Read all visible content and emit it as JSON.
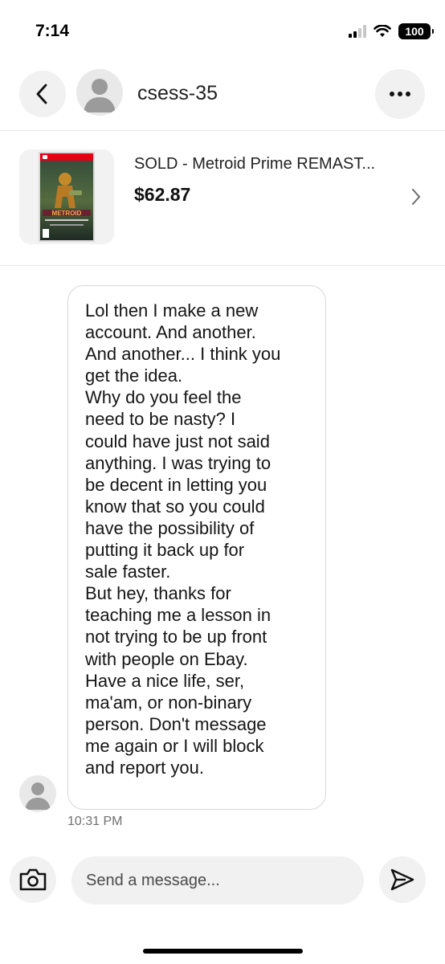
{
  "status_bar": {
    "time": "7:14",
    "battery": "100"
  },
  "header": {
    "username": "csess-35",
    "back_icon": "chevron-left-icon",
    "more_icon": "ellipsis-icon"
  },
  "item": {
    "title": "SOLD - Metroid Prime REMAST...",
    "price": "$62.87",
    "thumbnail_text": "METROID",
    "thumbnail_icon": "game-box-art"
  },
  "message": {
    "text": "Lol then I make a new\naccount. And another.\nAnd another... I think you\nget the idea.\nWhy do you feel the\nneed to be nasty? I\ncould have just not said\nanything. I was trying to\nbe decent in letting you\nknow that so you could\nhave the possibility of\nputting it back up for\nsale faster.\nBut hey, thanks for\nteaching me a lesson in\nnot trying to be up front\nwith people on Ebay.\nHave a nice life, ser,\nma'am, or non-binary\nperson. Don't message\nme again or I will block\nand report you.",
    "time": "10:31 PM"
  },
  "composer": {
    "placeholder": "Send a message..."
  },
  "colors": {
    "button_bg": "#f1f1f1",
    "bubble_border": "#d7d7d7",
    "avatar_bg": "#e9e9e9",
    "avatar_fg": "#9b9b9b"
  }
}
